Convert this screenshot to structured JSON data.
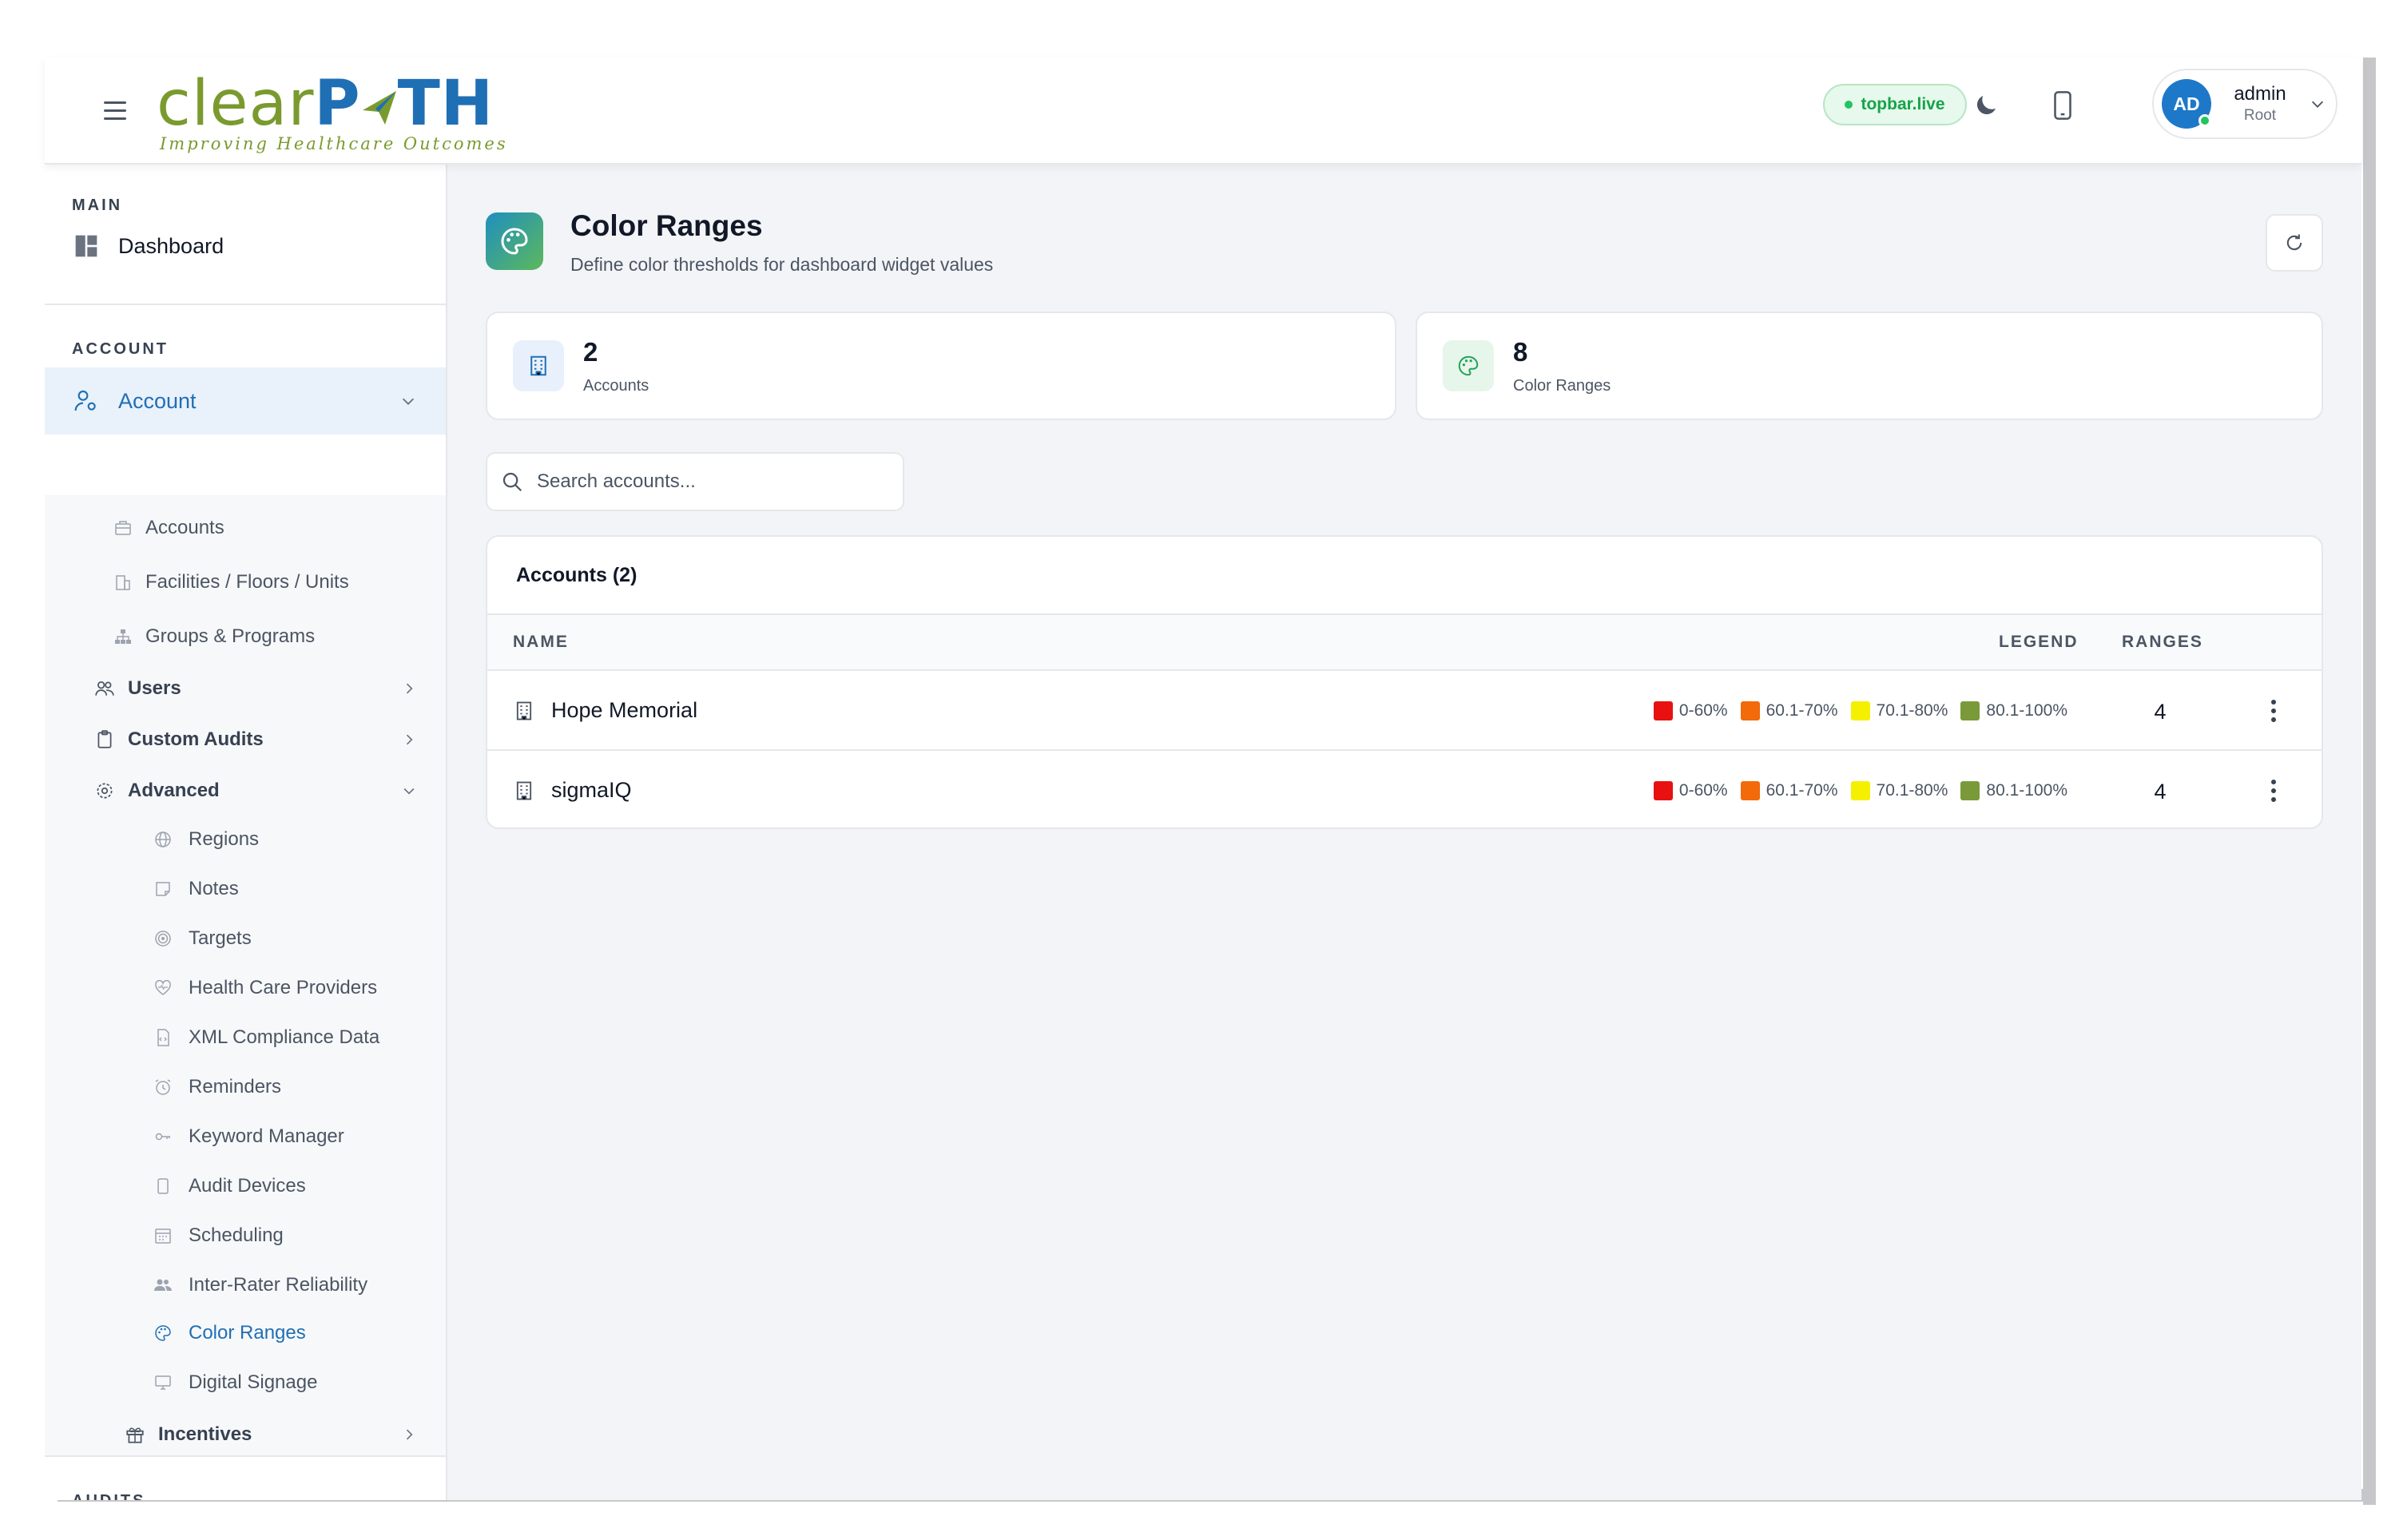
{
  "topbar": {
    "logo_clear": "clear",
    "logo_path": "P",
    "logo_path_end": "TH",
    "logo_tagline": "Improving Healthcare Outcomes",
    "live_badge": "topbar.live",
    "user": {
      "initials": "AD",
      "name": "admin",
      "role": "Root"
    }
  },
  "sidebar": {
    "main_title": "MAIN",
    "dashboard": "Dashboard",
    "account_title": "ACCOUNT",
    "account": "Account",
    "account_children": [
      "Accounts",
      "Facilities / Floors / Units",
      "Groups & Programs"
    ],
    "users": "Users",
    "custom_audits": "Custom Audits",
    "advanced": "Advanced",
    "advanced_children": [
      "Regions",
      "Notes",
      "Targets",
      "Health Care Providers",
      "XML Compliance Data",
      "Reminders",
      "Keyword Manager",
      "Audit Devices",
      "Scheduling",
      "Inter-Rater Reliability",
      "Color Ranges",
      "Digital Signage"
    ],
    "incentives": "Incentives",
    "audits_title": "AUDITS"
  },
  "page": {
    "title": "Color Ranges",
    "subtitle": "Define color thresholds for dashboard widget values"
  },
  "stats": [
    {
      "value": "2",
      "label": "Accounts"
    },
    {
      "value": "8",
      "label": "Color Ranges"
    }
  ],
  "search": {
    "placeholder": "Search accounts..."
  },
  "table": {
    "title": "Accounts (2)",
    "columns": {
      "name": "NAME",
      "legend": "LEGEND",
      "ranges": "RANGES"
    },
    "rows": [
      {
        "name": "Hope Memorial",
        "ranges": "4",
        "legend": [
          {
            "label": "0-60%",
            "color": "#e81010"
          },
          {
            "label": "60.1-70%",
            "color": "#f26a0a"
          },
          {
            "label": "70.1-80%",
            "color": "#f5f000"
          },
          {
            "label": "80.1-100%",
            "color": "#7a9a3a"
          }
        ]
      },
      {
        "name": "sigmaIQ",
        "ranges": "4",
        "legend": [
          {
            "label": "0-60%",
            "color": "#e81010"
          },
          {
            "label": "60.1-70%",
            "color": "#f26a0a"
          },
          {
            "label": "70.1-80%",
            "color": "#f5f000"
          },
          {
            "label": "80.1-100%",
            "color": "#7a9a3a"
          }
        ]
      }
    ]
  },
  "colors": {
    "accent": "#1f6fb5",
    "active_bg": "#e9f1fb",
    "live_green": "#16a34a"
  }
}
